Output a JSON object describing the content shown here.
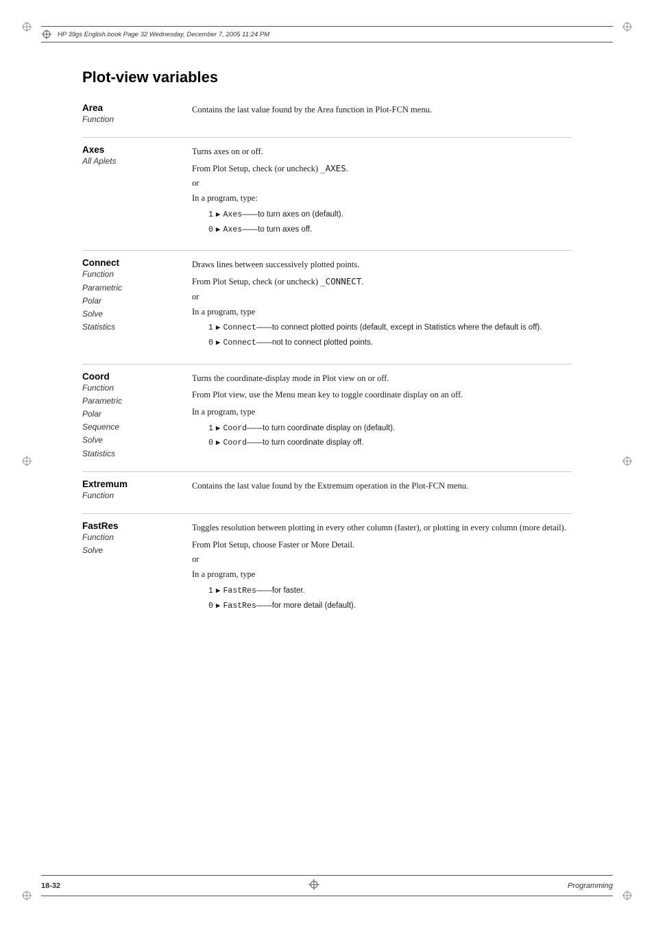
{
  "page": {
    "title": "Plot-view variables",
    "footer_left": "18-32",
    "footer_right": "Programming",
    "header_text": "HP 39gs English.book   Page 32  Wednesday, December 7, 2005  11:24 PM"
  },
  "entries": [
    {
      "term": "Area",
      "sub_terms": [
        "Function"
      ],
      "description": [
        {
          "type": "text",
          "content": "Contains the last value found by the Area function in Plot-FCN menu."
        }
      ]
    },
    {
      "term": "Axes",
      "sub_terms": [
        "All Aplets"
      ],
      "description": [
        {
          "type": "text",
          "content": "Turns axes on or off."
        },
        {
          "type": "text",
          "content": "From Plot Setup, check (or uncheck) _AXES."
        },
        {
          "type": "or"
        },
        {
          "type": "text",
          "content": "In a program, type:"
        },
        {
          "type": "code",
          "lines": [
            {
              "num": "1",
              "code": "Axes",
              "comment": "—to turn axes on (default)."
            },
            {
              "num": "0",
              "code": "Axes",
              "comment": "—to turn axes off."
            }
          ]
        }
      ]
    },
    {
      "term": "Connect",
      "sub_terms": [
        "Function",
        "Parametric",
        "Polar",
        "Solve",
        "Statistics"
      ],
      "description": [
        {
          "type": "text",
          "content": "Draws lines between successively plotted points."
        },
        {
          "type": "text",
          "content": "From Plot Setup, check (or uncheck) _CONNECT."
        },
        {
          "type": "or"
        },
        {
          "type": "text",
          "content": "In a program, type"
        },
        {
          "type": "code",
          "lines": [
            {
              "num": "1",
              "code": "Connect",
              "comment": "—to connect plotted points (default, except in Statistics where the default is off)."
            },
            {
              "num": "0",
              "code": "Connect",
              "comment": "—not to connect plotted points."
            }
          ]
        }
      ]
    },
    {
      "term": "Coord",
      "sub_terms": [
        "Function",
        "Parametric",
        "Polar",
        "Sequence",
        "Solve",
        "Statistics"
      ],
      "description": [
        {
          "type": "text",
          "content": "Turns the coordinate-display mode in Plot view on or off."
        },
        {
          "type": "text",
          "content": "From Plot view, use the Menu mean key to toggle coordinate display on an off."
        },
        {
          "type": "text",
          "content": "In a program, type"
        },
        {
          "type": "code",
          "lines": [
            {
              "num": "1",
              "code": "Coord",
              "comment": "—to turn coordinate display on (default)."
            },
            {
              "num": "0",
              "code": "Coord",
              "comment": "—to turn coordinate display off."
            }
          ]
        }
      ]
    },
    {
      "term": "Extremum",
      "sub_terms": [
        "Function"
      ],
      "description": [
        {
          "type": "text",
          "content": "Contains the last value found by the Extremum operation in the Plot-FCN menu."
        }
      ]
    },
    {
      "term": "FastRes",
      "sub_terms": [
        "Function",
        "Solve"
      ],
      "description": [
        {
          "type": "text",
          "content": "Toggles resolution between plotting in every other column (faster), or plotting in every column (more detail)."
        },
        {
          "type": "text",
          "content": "From Plot Setup, choose Faster or More Detail."
        },
        {
          "type": "or"
        },
        {
          "type": "text",
          "content": "In a program, type"
        },
        {
          "type": "code",
          "lines": [
            {
              "num": "1",
              "code": "FastRes",
              "comment": "—for faster."
            },
            {
              "num": "0",
              "code": "FastRes",
              "comment": "—for more detail (default)."
            }
          ]
        }
      ]
    }
  ],
  "icons": {
    "crosshair": "⊕",
    "arrow": "▶"
  }
}
